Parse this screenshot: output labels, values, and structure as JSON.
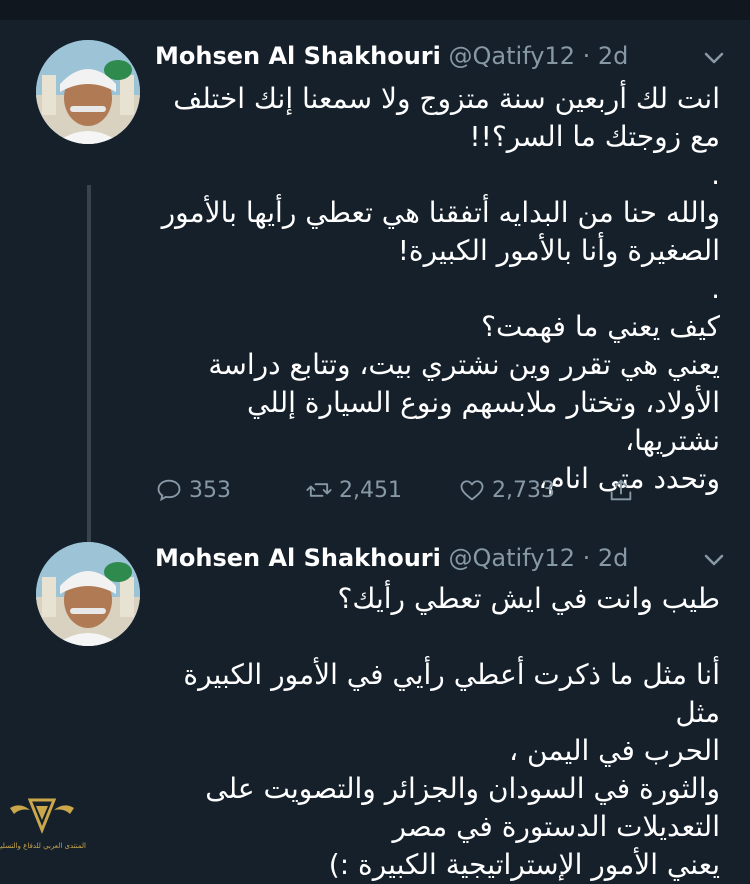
{
  "tweets": [
    {
      "author": "Mohsen Al Shakhouri",
      "handle": "@Qatify12",
      "time": "· 2d",
      "text": "انت لك أربعين سنة متزوج ولا سمعنا إنك اختلف\nمع زوجتك ما السر؟!!\n.\nوالله حنا من البدايه أتفقنا هي تعطي رأيها بالأمور\nالصغيرة وأنا بالأمور الكبيرة!\n.\nكيف يعني ما فهمت؟\nيعني هي تقرر وين نشتري بيت، وتتابع دراسة\nالأولاد، وتختار ملابسهم ونوع السيارة إللي نشتريها،\nوتحدد متى انام،",
      "replies": "353",
      "retweets": "2,451",
      "likes": "2,733"
    },
    {
      "author": "Mohsen Al Shakhouri",
      "handle": "@Qatify12",
      "time": "· 2d",
      "text": "طيب وانت في ايش تعطي رأيك؟\n\nأنا مثل ما ذكرت أعطي رأيي في الأمور الكبيرة مثل\nالحرب في اليمن ،\nوالثورة في السودان والجزائر والتصويت على\nالتعديلات الدستورة في مصر\nيعني الأمور الإستراتيجية الكبيرة :)"
    }
  ],
  "watermark": {
    "text": "المنتدى العربي للدفاع والتسليح"
  },
  "colors": {
    "background": "#15202b",
    "secondary_text": "#8899a6",
    "thread_line": "#38444d"
  },
  "icons": [
    "reply-icon",
    "retweet-icon",
    "like-icon",
    "share-icon",
    "chevron-down-icon"
  ]
}
